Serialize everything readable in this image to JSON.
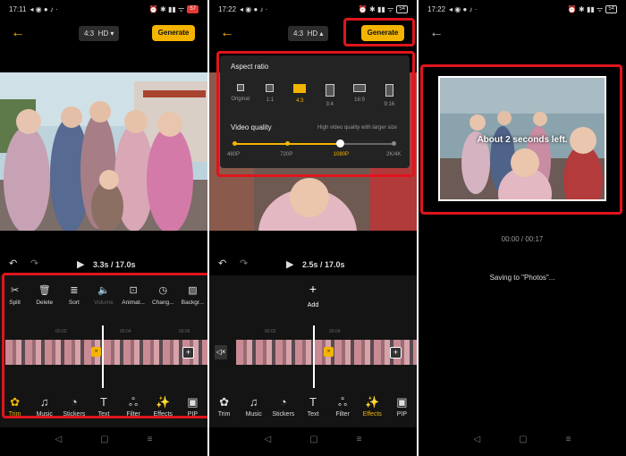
{
  "panel1": {
    "status": {
      "time": "17:11",
      "battery": "57"
    },
    "topbar": {
      "ratio_label": "4:3",
      "quality_label": "HD",
      "generate_label": "Generate"
    },
    "playback": {
      "time": "3.3s / 17.0s"
    },
    "tools": [
      {
        "label": "Split",
        "icon": "scissors-icon",
        "glyph": "✂",
        "dim": false
      },
      {
        "label": "Delete",
        "icon": "trash-icon",
        "glyph": "🗑",
        "dim": false
      },
      {
        "label": "Sort",
        "icon": "list-icon",
        "glyph": "≣",
        "dim": false
      },
      {
        "label": "Volume",
        "icon": "speaker-icon",
        "glyph": "🔈",
        "dim": true
      },
      {
        "label": "Animat...",
        "icon": "animation-icon",
        "glyph": "⊡",
        "dim": false
      },
      {
        "label": "Chang...",
        "icon": "speed-icon",
        "glyph": "◷",
        "dim": false
      },
      {
        "label": "Backgr...",
        "icon": "background-icon",
        "glyph": "▨",
        "dim": false
      }
    ],
    "ticks": [
      "00:02",
      "00:04",
      "00:06"
    ],
    "bottom": [
      {
        "label": "Trim",
        "icon": "trim-icon",
        "glyph": "✿",
        "active": true
      },
      {
        "label": "Music",
        "icon": "music-icon",
        "glyph": "♫",
        "active": false
      },
      {
        "label": "Stickers",
        "icon": "sticker-icon",
        "glyph": "◔",
        "active": false
      },
      {
        "label": "Text",
        "icon": "text-icon",
        "glyph": "T",
        "active": false
      },
      {
        "label": "Filter",
        "icon": "filter-icon",
        "glyph": "ஃ",
        "active": false
      },
      {
        "label": "Effects",
        "icon": "effects-icon",
        "glyph": "✨",
        "active": false
      },
      {
        "label": "PIP",
        "icon": "pip-icon",
        "glyph": "▣",
        "active": false
      }
    ]
  },
  "panel2": {
    "status": {
      "time": "17:22",
      "battery": "54"
    },
    "topbar": {
      "ratio_label": "4:3",
      "quality_label": "HD",
      "generate_label": "Generate"
    },
    "aspect": {
      "title": "Aspect ratio",
      "options": [
        {
          "label": "Original",
          "selected": false
        },
        {
          "label": "1:1",
          "selected": false
        },
        {
          "label": "4:3",
          "selected": true
        },
        {
          "label": "3:4",
          "selected": false
        },
        {
          "label": "16:9",
          "selected": false
        },
        {
          "label": "9:16",
          "selected": false
        }
      ]
    },
    "quality": {
      "title": "Video quality",
      "hint": "High video quality with larger size",
      "options": [
        "480P",
        "720P",
        "1080P",
        "2K/4K"
      ],
      "selected_index": 2
    },
    "playback": {
      "time": "2.5s / 17.0s"
    },
    "add_label": "Add",
    "ticks": [
      "00:02",
      "00:04"
    ],
    "bottom": [
      {
        "label": "Trim",
        "icon": "trim-icon",
        "glyph": "✿",
        "active": false
      },
      {
        "label": "Music",
        "icon": "music-icon",
        "glyph": "♫",
        "active": false
      },
      {
        "label": "Stickers",
        "icon": "sticker-icon",
        "glyph": "◔",
        "active": false
      },
      {
        "label": "Text",
        "icon": "text-icon",
        "glyph": "T",
        "active": false
      },
      {
        "label": "Filter",
        "icon": "filter-icon",
        "glyph": "ஃ",
        "active": false
      },
      {
        "label": "Effects",
        "icon": "effects-icon",
        "glyph": "✨",
        "active": true
      },
      {
        "label": "PIP",
        "icon": "pip-icon",
        "glyph": "▣",
        "active": false
      }
    ]
  },
  "panel3": {
    "status": {
      "time": "17:22",
      "battery": "54"
    },
    "overlay": "About 2 seconds left.",
    "time": "00:00 / 00:17",
    "saving": "Saving to \"Photos\"..."
  },
  "colors": {
    "accent": "#f3b400",
    "highlight": "#e0151d",
    "background": "#000000"
  }
}
